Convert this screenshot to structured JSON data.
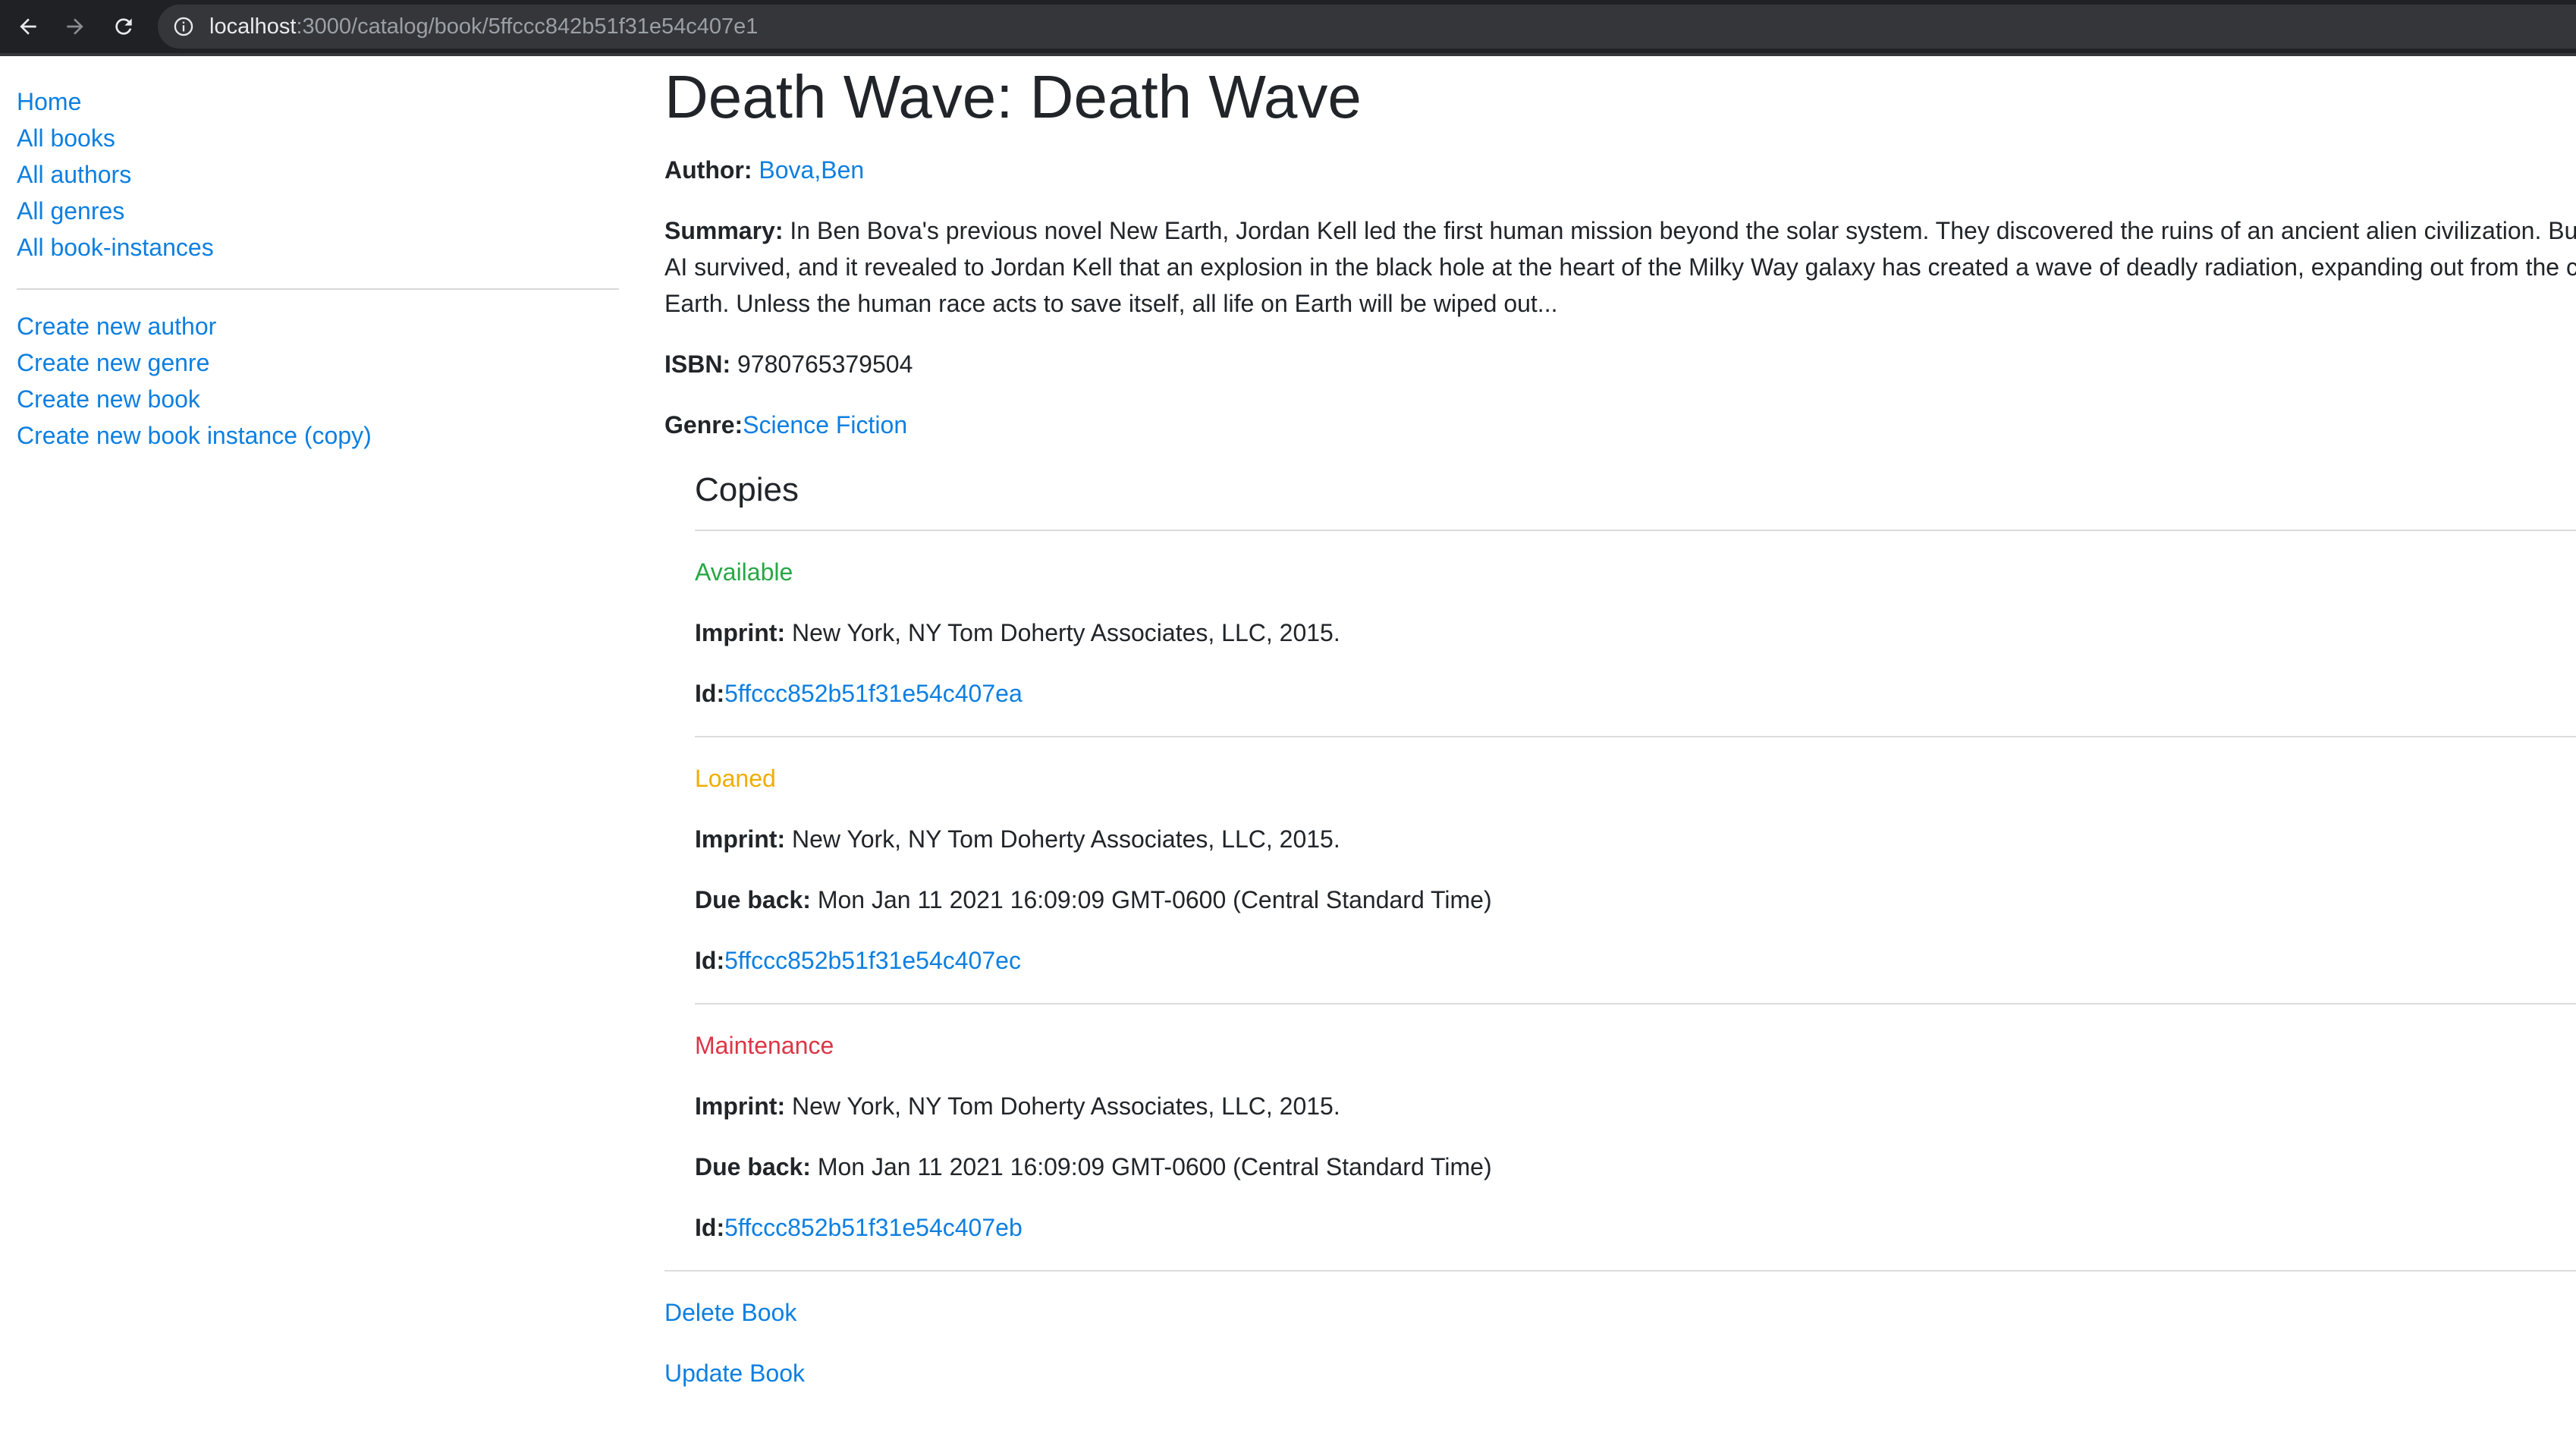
{
  "browser": {
    "url_host": "localhost",
    "url_path": ":3000/catalog/book/5ffccc842b51f31e54c407e1"
  },
  "sidebar": {
    "primary": [
      {
        "label": "Home"
      },
      {
        "label": "All books"
      },
      {
        "label": "All authors"
      },
      {
        "label": "All genres"
      },
      {
        "label": "All book-instances"
      }
    ],
    "secondary": [
      {
        "label": "Create new author"
      },
      {
        "label": "Create new genre"
      },
      {
        "label": "Create new book"
      },
      {
        "label": "Create new book instance (copy)"
      }
    ]
  },
  "book": {
    "title": "Death Wave: Death Wave",
    "author_label": "Author:",
    "author": "Bova,Ben",
    "summary_label": "Summary:",
    "summary": "In Ben Bova's previous novel New Earth, Jordan Kell led the first human mission beyond the solar system. They discovered the ruins of an ancient alien civilization. But one alien AI survived, and it revealed to Jordan Kell that an explosion in the black hole at the heart of the Milky Way galaxy has created a wave of deadly radiation, expanding out from the core toward Earth. Unless the human race acts to save itself, all life on Earth will be wiped out...",
    "isbn_label": "ISBN:",
    "isbn": "9780765379504",
    "genre_label": "Genre:",
    "genre": "Science Fiction"
  },
  "copies": {
    "heading": "Copies",
    "imprint_label": "Imprint:",
    "due_label": "Due back:",
    "id_label": "Id:",
    "items": [
      {
        "status": "Available",
        "imprint": "New York, NY Tom Doherty Associates, LLC, 2015.",
        "id": "5ffccc852b51f31e54c407ea"
      },
      {
        "status": "Loaned",
        "imprint": "New York, NY Tom Doherty Associates, LLC, 2015.",
        "due_back": "Mon Jan 11 2021 16:09:09 GMT-0600 (Central Standard Time)",
        "id": "5ffccc852b51f31e54c407ec"
      },
      {
        "status": "Maintenance",
        "imprint": "New York, NY Tom Doherty Associates, LLC, 2015.",
        "due_back": "Mon Jan 11 2021 16:09:09 GMT-0600 (Central Standard Time)",
        "id": "5ffccc852b51f31e54c407eb"
      }
    ]
  },
  "actions": {
    "delete": "Delete Book",
    "update": "Update Book"
  },
  "colors": {
    "link": "#0d7fe0",
    "available": "#28a745",
    "loaned": "#f0ad00",
    "maintenance": "#dc3545"
  }
}
